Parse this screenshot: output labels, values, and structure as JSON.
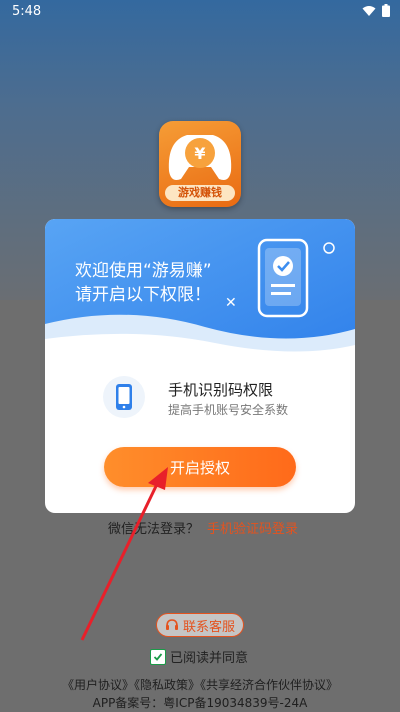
{
  "status_bar": {
    "time": "5:48"
  },
  "app": {
    "logo_label": "游戏赚钱"
  },
  "dialog": {
    "welcome_line1": "欢迎使用“游易赚”",
    "welcome_line2": "请开启以下权限！",
    "permission": {
      "title": "手机识别码权限",
      "description": "提高手机账号安全系数"
    },
    "authorize_label": "开启授权"
  },
  "alt_login": {
    "prompt": "微信无法登录？",
    "link": "手机验证码登录"
  },
  "customer_service": "联系客服",
  "agreement": "已阅读并同意",
  "policies": [
    "《用户协议》",
    "《隐私政策》",
    "《共享经济合作伙伴协议》"
  ],
  "icp": "APP备案号：粤ICP备19034839号-24A",
  "colors": {
    "accent": "#e4531f",
    "button": "#ff7a22",
    "dialog_header": "#3d8ef0",
    "check": "#1a9b48"
  }
}
